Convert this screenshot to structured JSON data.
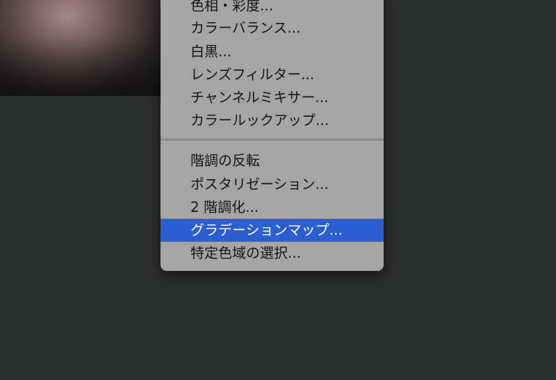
{
  "menu": {
    "group1": [
      {
        "label": "色相・彩度..."
      },
      {
        "label": "カラーバランス..."
      },
      {
        "label": "白黒..."
      },
      {
        "label": "レンズフィルター..."
      },
      {
        "label": "チャンネルミキサー..."
      },
      {
        "label": "カラールックアップ..."
      }
    ],
    "group2": [
      {
        "label": "階調の反転"
      },
      {
        "label": "ポスタリゼーション..."
      },
      {
        "label": "2 階調化..."
      },
      {
        "label": "グラデーションマップ...",
        "selected": true
      },
      {
        "label": "特定色域の選択..."
      }
    ]
  },
  "colors": {
    "background": "#2b2c2c",
    "menu_background": "#a5a5a5",
    "highlight": "#2b5ed0"
  }
}
